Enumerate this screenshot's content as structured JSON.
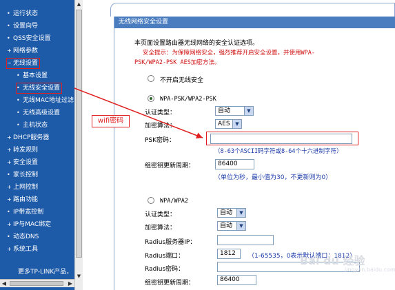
{
  "sidebar": {
    "items": [
      {
        "label": "运行状态",
        "bullet": "•"
      },
      {
        "label": "设置向导",
        "bullet": "•"
      },
      {
        "label": "QSS安全设置",
        "bullet": "•"
      },
      {
        "label": "网络参数",
        "bullet": "+"
      },
      {
        "label": "无线设置",
        "bullet": "−"
      },
      {
        "label": "基本设置",
        "bullet": "•"
      },
      {
        "label": "无线安全设置",
        "bullet": "•"
      },
      {
        "label": "无线MAC地址过滤",
        "bullet": "•"
      },
      {
        "label": "无线高级设置",
        "bullet": "•"
      },
      {
        "label": "主机状态",
        "bullet": "•"
      },
      {
        "label": "DHCP服务器",
        "bullet": "+"
      },
      {
        "label": "转发规则",
        "bullet": "+"
      },
      {
        "label": "安全设置",
        "bullet": "+"
      },
      {
        "label": "家长控制",
        "bullet": "•"
      },
      {
        "label": "上网控制",
        "bullet": "+"
      },
      {
        "label": "路由功能",
        "bullet": "+"
      },
      {
        "label": "IP带宽控制",
        "bullet": "•"
      },
      {
        "label": "IP与MAC绑定",
        "bullet": "+"
      },
      {
        "label": "动态DNS",
        "bullet": "•"
      },
      {
        "label": "系统工具",
        "bullet": "+"
      }
    ],
    "more_text": "更多TP-LINK产品，",
    "scroll_left": "◀",
    "scroll_right": "▶",
    "scroll_up": "▲",
    "scroll_down": "▼"
  },
  "panel": {
    "title": "无线网络安全设置",
    "intro": "本页面设置路由器无线网络的安全认证选项。",
    "warning_line1": "安全提示：为保障网络安全，强烈推荐开启安全设置，并使用WPA-",
    "warning_line2": "PSK/WPA2-PSK AES加密方法。",
    "option_none": "不开启无线安全",
    "option_wpa_psk": "WPA-PSK/WPA2-PSK",
    "psk": {
      "auth_label": "认证类型：",
      "auth_value": "自动",
      "enc_label": "加密算法：",
      "enc_value": "AES",
      "password_label": "PSK密码：",
      "password_value": "",
      "password_hint": "（8-63个ASCII码字符或8-64个十六进制字符）",
      "group_label": "组密钥更新周期：",
      "group_value": "86400",
      "group_hint": "（单位为秒，最小值为30，不更新则为0）"
    },
    "option_wpa": "WPA/WPA2",
    "wpa": {
      "auth_label": "认证类型：",
      "auth_value": "自动",
      "enc_label": "加密算法：",
      "enc_value": "自动",
      "radius_ip_label": "Radius服务器IP：",
      "radius_ip_value": "",
      "radius_port_label": "Radius端口：",
      "radius_port_value": "1812",
      "radius_port_hint": "（1-65535，0表示默认端口：1812）",
      "radius_pwd_label": "Radius密码：",
      "radius_pwd_value": "",
      "group_label": "组密钥更新周期：",
      "group_value": "86400"
    }
  },
  "annotation": {
    "label": "wifi密码",
    "color": "#e02020"
  },
  "watermark": {
    "text": "Bai du 经验",
    "sub": "jingyan.baidu.com"
  },
  "colors": {
    "sidebar_bg": "#1d5aa8",
    "header_bg": "#4a7dbf",
    "warning": "#d01010",
    "hint": "#1a3aa8",
    "highlight": "#e02020"
  }
}
